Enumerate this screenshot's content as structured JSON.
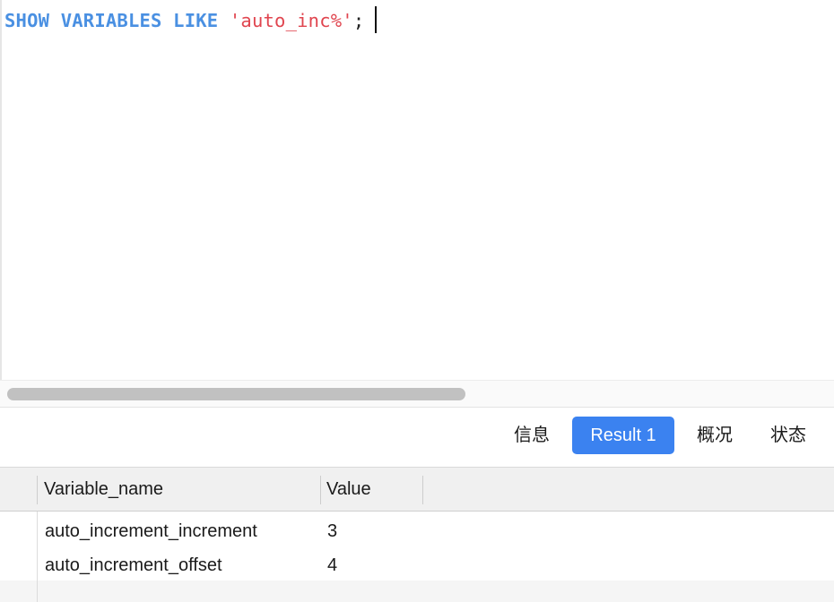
{
  "editor": {
    "sql": {
      "kw1": "SHOW",
      "kw2": "VARIABLES",
      "kw3": "LIKE",
      "string": "'auto_inc%'",
      "terminator": ";"
    }
  },
  "results": {
    "tabs": [
      {
        "label": "信息",
        "active": false
      },
      {
        "label": "Result 1",
        "active": true
      },
      {
        "label": "概况",
        "active": false
      },
      {
        "label": "状态",
        "active": false
      }
    ],
    "columns": [
      "Variable_name",
      "Value"
    ],
    "rows": [
      [
        "auto_increment_increment",
        "3"
      ],
      [
        "auto_increment_offset",
        "4"
      ]
    ]
  },
  "colors": {
    "keyword": "#4a90e2",
    "string": "#e0454f",
    "active_tab": "#3b82f0"
  }
}
